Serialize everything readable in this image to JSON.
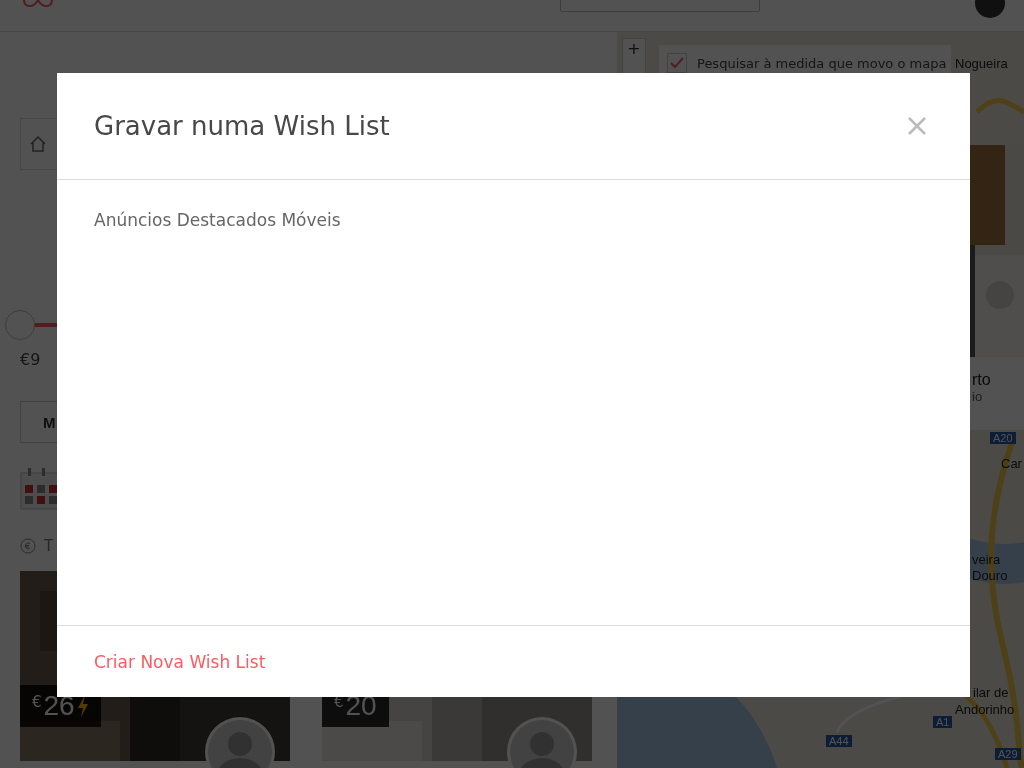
{
  "filters": {
    "price_slider": {
      "level": 0
    },
    "price_min": "€9",
    "room_button": "M",
    "note": "T"
  },
  "listings": [
    {
      "currency": "€",
      "price": "26",
      "instant": true
    },
    {
      "currency": "€",
      "price": "20",
      "instant": false
    }
  ],
  "map": {
    "zoom_in": "+",
    "search_checkbox": {
      "label": "Pesquisar à medida que movo o mapa",
      "checked": true
    },
    "labels": [
      {
        "kind": "place",
        "text": "Nogueira"
      },
      {
        "kind": "road",
        "text": "A20"
      },
      {
        "kind": "place",
        "text": "Car"
      },
      {
        "kind": "place",
        "text": "veira\nDouro"
      },
      {
        "kind": "place",
        "text": "ilar de"
      },
      {
        "kind": "place",
        "text": "Andorinho"
      },
      {
        "kind": "road",
        "text": "A1"
      },
      {
        "kind": "road",
        "text": "A44"
      },
      {
        "kind": "road",
        "text": "A29"
      }
    ],
    "card_peek": {
      "title": "rto",
      "subtitle": "io"
    }
  },
  "modal": {
    "title": "Gravar numa Wish List",
    "wish_lists": [
      "Anúncios Destacados Móveis"
    ],
    "create_link": "Criar Nova Wish List"
  }
}
